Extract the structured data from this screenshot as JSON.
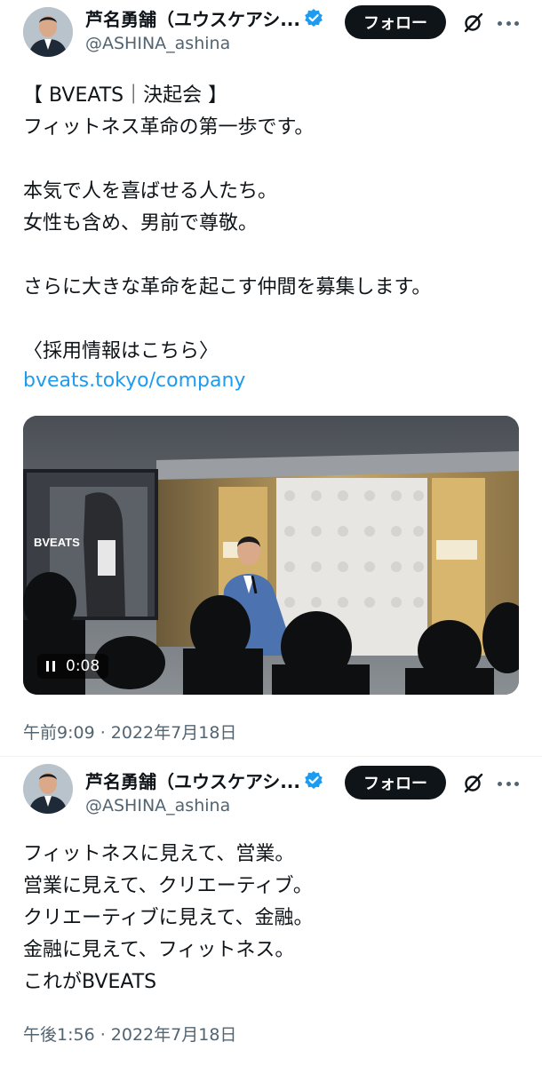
{
  "tweets": [
    {
      "author_name": "芦名勇舗（ユウスケアシ...",
      "handle": "@ASHINA_ashina",
      "follow_label": "フォロー",
      "text": "【 BVEATS｜決起会 】\nフィットネス革命の第一歩です。\n\n本気で人を喜ばせる人たち。\n女性も含め、男前で尊敬。\n\nさらに大きな革命を起こす仲間を募集します。\n\n〈採用情報はこちら〉",
      "link": "bveats.tokyo/company",
      "video": {
        "time": "0:08",
        "screen_text": "BVEATS"
      },
      "timestamp": "午前9:09 · 2022年7月18日"
    },
    {
      "author_name": "芦名勇舗（ユウスケアシ...",
      "handle": "@ASHINA_ashina",
      "follow_label": "フォロー",
      "text": "フィットネスに見えて、営業。\n営業に見えて、クリエーティブ。\nクリエーティブに見えて、金融。\n金融に見えて、フィットネス。\nこれがBVEATS",
      "timestamp": "午後1:56 · 2022年7月18日"
    }
  ],
  "colors": {
    "accent": "#1d9bf0",
    "text": "#0f1419",
    "muted": "#536471",
    "button": "#0f1419"
  },
  "icons": {
    "verified": "verified-badge-icon",
    "grok": "grok-icon",
    "more": "more-icon",
    "pause": "pause-icon"
  }
}
